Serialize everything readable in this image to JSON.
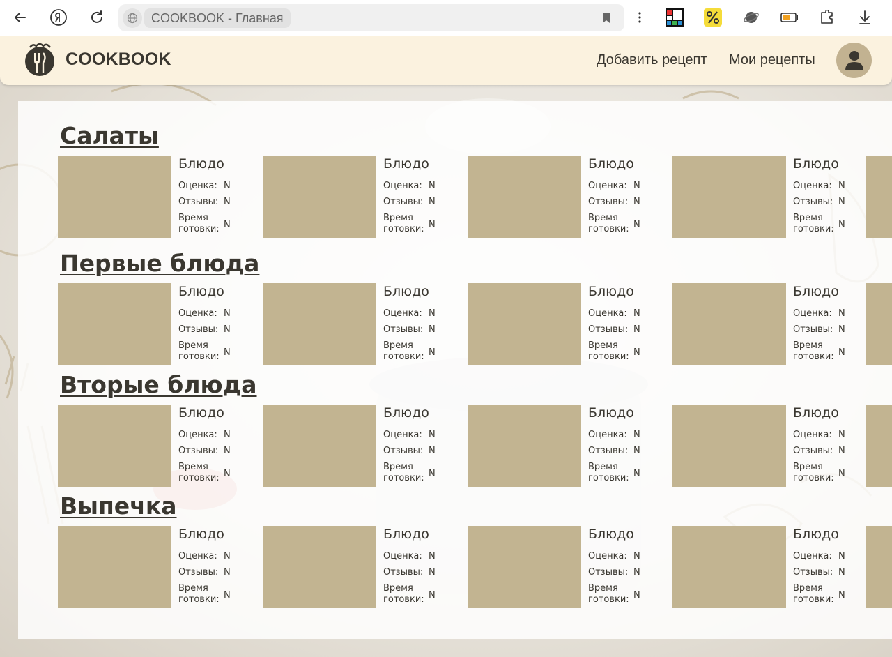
{
  "browser": {
    "address_text": "COOKBOOK - Главная"
  },
  "site": {
    "brand": "COOKBOOK",
    "nav": {
      "add_recipe": "Добавить рецепт",
      "my_recipes": "Мои рецепты"
    },
    "colors": {
      "header_bg": "#fbf2df",
      "placeholder": "#c2b491",
      "text": "#3a3730",
      "avatar_bg": "#c2b291"
    }
  },
  "sections": [
    {
      "title": "Салаты",
      "cards": [
        {
          "name": "Блюдо",
          "rating_label": "Оценка:",
          "rating": "N",
          "reviews_label": "Отзывы:",
          "reviews": "N",
          "time_label_1": "Время",
          "time_label_2": "готовки:",
          "time": "N"
        },
        {
          "name": "Блюдо",
          "rating_label": "Оценка:",
          "rating": "N",
          "reviews_label": "Отзывы:",
          "reviews": "N",
          "time_label_1": "Время",
          "time_label_2": "готовки:",
          "time": "N"
        },
        {
          "name": "Блюдо",
          "rating_label": "Оценка:",
          "rating": "N",
          "reviews_label": "Отзывы:",
          "reviews": "N",
          "time_label_1": "Время",
          "time_label_2": "готовки:",
          "time": "N"
        },
        {
          "name": "Блюдо",
          "rating_label": "Оценка:",
          "rating": "N",
          "reviews_label": "Отзывы:",
          "reviews": "N",
          "time_label_1": "Время",
          "time_label_2": "готовки:",
          "time": "N"
        },
        {
          "name": "",
          "rating_label": "",
          "rating": "",
          "reviews_label": "",
          "reviews": "",
          "time_label_1": "",
          "time_label_2": "",
          "time": ""
        }
      ]
    },
    {
      "title": "Первые блюда",
      "cards": [
        {
          "name": "Блюдо",
          "rating_label": "Оценка:",
          "rating": "N",
          "reviews_label": "Отзывы:",
          "reviews": "N",
          "time_label_1": "Время",
          "time_label_2": "готовки:",
          "time": "N"
        },
        {
          "name": "Блюдо",
          "rating_label": "Оценка:",
          "rating": "N",
          "reviews_label": "Отзывы:",
          "reviews": "N",
          "time_label_1": "Время",
          "time_label_2": "готовки:",
          "time": "N"
        },
        {
          "name": "Блюдо",
          "rating_label": "Оценка:",
          "rating": "N",
          "reviews_label": "Отзывы:",
          "reviews": "N",
          "time_label_1": "Время",
          "time_label_2": "готовки:",
          "time": "N"
        },
        {
          "name": "Блюдо",
          "rating_label": "Оценка:",
          "rating": "N",
          "reviews_label": "Отзывы:",
          "reviews": "N",
          "time_label_1": "Время",
          "time_label_2": "готовки:",
          "time": "N"
        },
        {
          "name": "",
          "rating_label": "",
          "rating": "",
          "reviews_label": "",
          "reviews": "",
          "time_label_1": "",
          "time_label_2": "",
          "time": ""
        }
      ]
    },
    {
      "title": "Вторые блюда",
      "cards": [
        {
          "name": "Блюдо",
          "rating_label": "Оценка:",
          "rating": "N",
          "reviews_label": "Отзывы:",
          "reviews": "N",
          "time_label_1": "Время",
          "time_label_2": "готовки:",
          "time": "N"
        },
        {
          "name": "Блюдо",
          "rating_label": "Оценка:",
          "rating": "N",
          "reviews_label": "Отзывы:",
          "reviews": "N",
          "time_label_1": "Время",
          "time_label_2": "готовки:",
          "time": "N"
        },
        {
          "name": "Блюдо",
          "rating_label": "Оценка:",
          "rating": "N",
          "reviews_label": "Отзывы:",
          "reviews": "N",
          "time_label_1": "Время",
          "time_label_2": "готовки:",
          "time": "N"
        },
        {
          "name": "Блюдо",
          "rating_label": "Оценка:",
          "rating": "N",
          "reviews_label": "Отзывы:",
          "reviews": "N",
          "time_label_1": "Время",
          "time_label_2": "готовки:",
          "time": "N"
        },
        {
          "name": "",
          "rating_label": "",
          "rating": "",
          "reviews_label": "",
          "reviews": "",
          "time_label_1": "",
          "time_label_2": "",
          "time": ""
        }
      ]
    },
    {
      "title": "Выпечка",
      "cards": [
        {
          "name": "Блюдо",
          "rating_label": "Оценка:",
          "rating": "N",
          "reviews_label": "Отзывы:",
          "reviews": "N",
          "time_label_1": "Время",
          "time_label_2": "готовки:",
          "time": "N"
        },
        {
          "name": "Блюдо",
          "rating_label": "Оценка:",
          "rating": "N",
          "reviews_label": "Отзывы:",
          "reviews": "N",
          "time_label_1": "Время",
          "time_label_2": "готовки:",
          "time": "N"
        },
        {
          "name": "Блюдо",
          "rating_label": "Оценка:",
          "rating": "N",
          "reviews_label": "Отзывы:",
          "reviews": "N",
          "time_label_1": "Время",
          "time_label_2": "готовки:",
          "time": "N"
        },
        {
          "name": "Блюдо",
          "rating_label": "Оценка:",
          "rating": "N",
          "reviews_label": "Отзывы:",
          "reviews": "N",
          "time_label_1": "Время",
          "time_label_2": "готовки:",
          "time": "N"
        },
        {
          "name": "",
          "rating_label": "",
          "rating": "",
          "reviews_label": "",
          "reviews": "",
          "time_label_1": "",
          "time_label_2": "",
          "time": ""
        }
      ]
    }
  ]
}
